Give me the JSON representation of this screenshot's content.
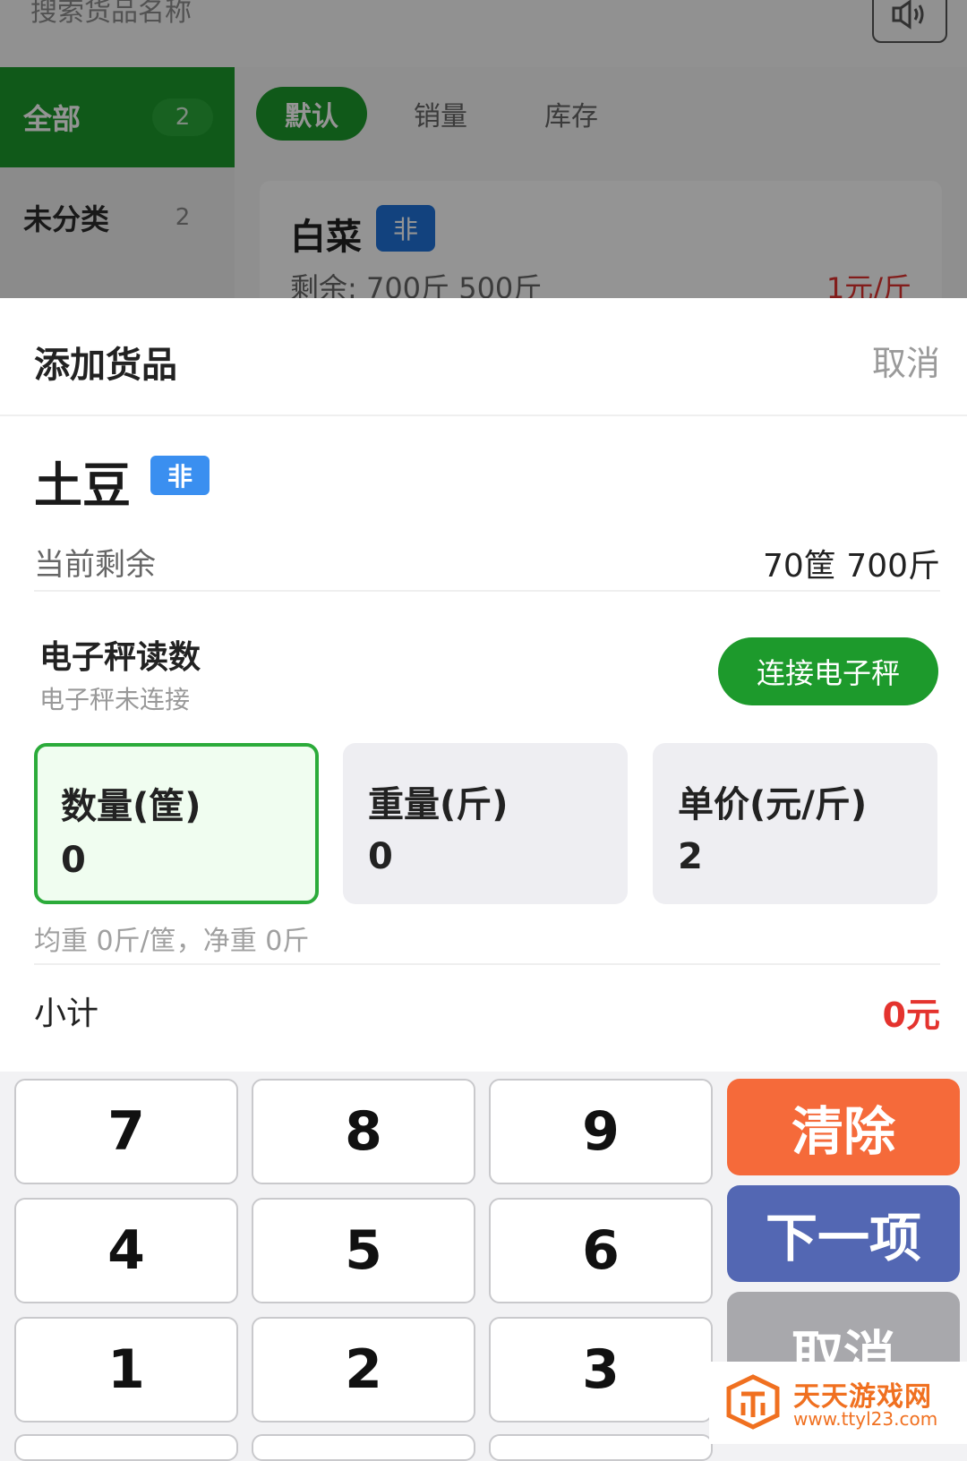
{
  "background": {
    "search_placeholder": "搜索货品名称",
    "sidebar": [
      {
        "label": "全部",
        "count": "2"
      },
      {
        "label": "未分类",
        "count": "2"
      }
    ],
    "sort_tabs": [
      "默认",
      "销量",
      "库存"
    ],
    "product": {
      "name": "白菜",
      "tag": "非",
      "remaining": "剩余: 700斤 500斤",
      "price": "1元/斤"
    }
  },
  "sheet": {
    "title": "添加货品",
    "cancel": "取消",
    "product_name": "土豆",
    "product_tag": "非",
    "remaining_label": "当前剩余",
    "remaining_value": "70筐 700斤",
    "scale_title": "电子秤读数",
    "scale_status": "电子秤未连接",
    "connect_button": "连接电子秤",
    "fields": [
      {
        "label": "数量(筐)",
        "value": "0"
      },
      {
        "label": "重量(斤)",
        "value": "0"
      },
      {
        "label": "单价(元/斤)",
        "value": "2"
      }
    ],
    "avg_line": "均重 0斤/筐，净重 0斤",
    "subtotal_label": "小计",
    "subtotal_value": "0元"
  },
  "keypad": {
    "keys": [
      "7",
      "8",
      "9",
      "4",
      "5",
      "6",
      "1",
      "2",
      "3"
    ],
    "clear": "清除",
    "next": "下一项",
    "cancel": "取消"
  },
  "watermark": {
    "name": "天天游戏网",
    "url": "www.ttyl23.com"
  },
  "colors": {
    "green": "#1d9a2c",
    "red": "#e4332e",
    "orange": "#f56a3a",
    "blue": "#5367b3",
    "grey": "#a8a8ac"
  }
}
